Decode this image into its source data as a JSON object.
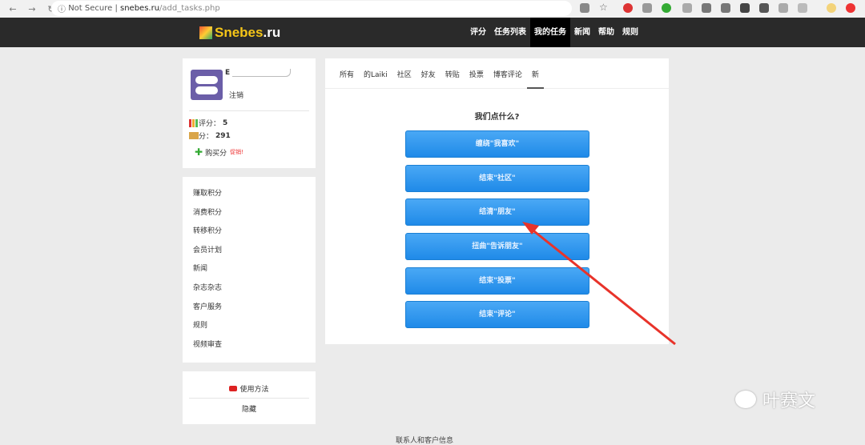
{
  "browser": {
    "security": "Not Secure",
    "host": "snebes.ru",
    "path": "/add_tasks.php"
  },
  "site": {
    "logo_main": "Snebes",
    "logo_tld": ".ru",
    "nav": [
      "评分",
      "任务列表",
      "我的任务",
      "新闻",
      "帮助",
      "规则"
    ],
    "active_nav": "我的任务"
  },
  "profile": {
    "name_initial": "E",
    "logout": "注销",
    "rating_label": "评分：",
    "rating": "5",
    "points_label": "分：",
    "points": "291",
    "buy": "购买分",
    "promo": "促销!"
  },
  "menu": [
    "赚取积分",
    "消费积分",
    "转移积分",
    "会员计划",
    "新闻",
    "杂志杂志",
    "客户服务",
    "规则",
    "视频审查"
  ],
  "video": {
    "howto": "使用方法",
    "hide": "隐藏"
  },
  "main": {
    "tabs": [
      "所有",
      "的Laiki",
      "社区",
      "好友",
      "转贴",
      "投票",
      "博客评论",
      "新"
    ],
    "active_tab": "新",
    "question": "我们点什么?",
    "buttons": [
      "缠绕\"我喜欢\"",
      "结束\"社区\"",
      "结清\"朋友\"",
      "扭曲\"告诉朋友\"",
      "结束\"投票\"",
      "结束\"评论\""
    ]
  },
  "footer": "联系人和客户信息",
  "watermark": "叶赛文",
  "colors": {
    "button": "#2196f3",
    "header": "#2a2a2a",
    "annotation_arrow": "#e8332a"
  }
}
